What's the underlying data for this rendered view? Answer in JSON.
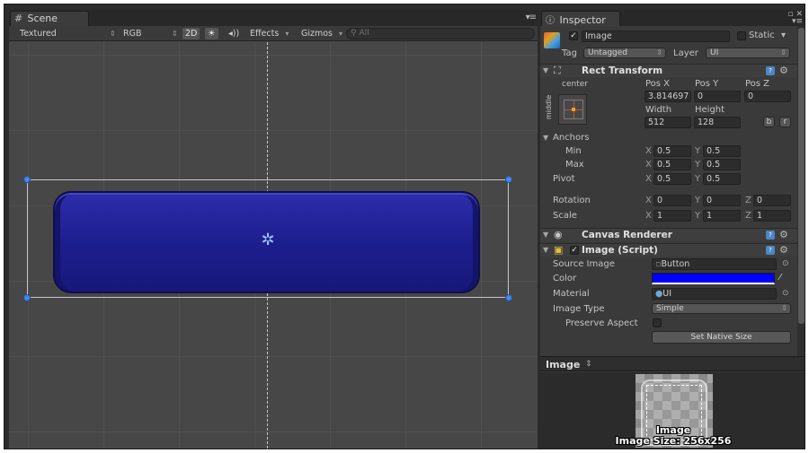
{
  "scene": {
    "tab_label": "Scene",
    "tab_icon": "grid-icon",
    "toolbar": {
      "render_mode": "Textured",
      "color_mode": "RGB",
      "mode_2d": "2D",
      "lighting_icon": "sun-icon",
      "audio_icon": "speaker-icon",
      "effects": "Effects",
      "gizmos": "Gizmos",
      "search_placeholder": "All"
    }
  },
  "inspector": {
    "tab_label": "Inspector",
    "object": {
      "active": true,
      "name": "Image",
      "static_label": "Static",
      "tag_label": "Tag",
      "tag_value": "Untagged",
      "layer_label": "Layer",
      "layer_value": "UI"
    },
    "rect_transform": {
      "title": "Rect Transform",
      "anchor_preset_h": "center",
      "anchor_preset_v": "middle",
      "pos_x_label": "Pos X",
      "pos_y_label": "Pos Y",
      "pos_z_label": "Pos Z",
      "pos_x": "3.814697",
      "pos_y": "0",
      "pos_z": "0",
      "width_label": "Width",
      "height_label": "Height",
      "width": "512",
      "height": "128",
      "blueprint_btn": "b",
      "raw_btn": "r",
      "anchors_label": "Anchors",
      "min_label": "Min",
      "max_label": "Max",
      "min_x": "0.5",
      "min_y": "0.5",
      "max_x": "0.5",
      "max_y": "0.5",
      "pivot_label": "Pivot",
      "pivot_x": "0.5",
      "pivot_y": "0.5",
      "rotation_label": "Rotation",
      "rot_x": "0",
      "rot_y": "0",
      "rot_z": "0",
      "scale_label": "Scale",
      "scale_x": "1",
      "scale_y": "1",
      "scale_z": "1",
      "axis_x": "X",
      "axis_y": "Y",
      "axis_z": "Z"
    },
    "canvas_renderer": {
      "title": "Canvas Renderer"
    },
    "image_script": {
      "title": "Image (Script)",
      "enabled": true,
      "source_image_label": "Source Image",
      "source_image_value": "Button",
      "color_label": "Color",
      "color_value": "#0000ff",
      "material_label": "Material",
      "material_value": "UI",
      "image_type_label": "Image Type",
      "image_type_value": "Simple",
      "preserve_aspect_label": "Preserve Aspect",
      "preserve_aspect": false,
      "set_native_size": "Set Native Size"
    },
    "preview": {
      "header": "Image",
      "caption_name": "Image",
      "caption_size": "Image Size: 256x256"
    }
  }
}
